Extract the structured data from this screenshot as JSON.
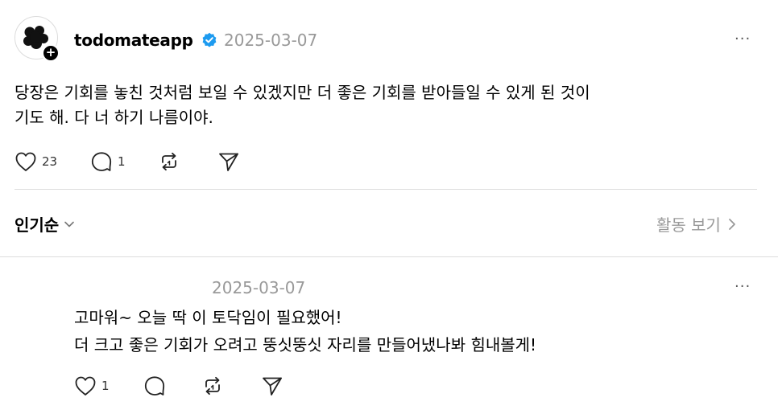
{
  "post": {
    "username": "todomateapp",
    "date": "2025-03-07",
    "text_line1": "당장은 기회를 놓친 것처럼 보일 수 있겠지만 더 좋은 기회를 받아들일 수 있게 된 것이",
    "text_line2": "기도 해. 다 너 하기 나름이야.",
    "like_count": "23",
    "reply_count": "1",
    "more_label": "···"
  },
  "sort_bar": {
    "sort_label": "인기순",
    "activity_label": "활동 보기"
  },
  "reply": {
    "date": "2025-03-07",
    "text_line1": "고마워~ 오늘 딱 이 토닥임이 필요했어!",
    "text_line2": "더 크고 좋은 기회가 오려고 뚱싯뚱싯 자리를 만들어냈나봐 힘내볼게!",
    "like_count": "1",
    "more_label": "···"
  },
  "icons": {
    "verified_color": "#1d9bf0",
    "avatar_plus": "+"
  }
}
